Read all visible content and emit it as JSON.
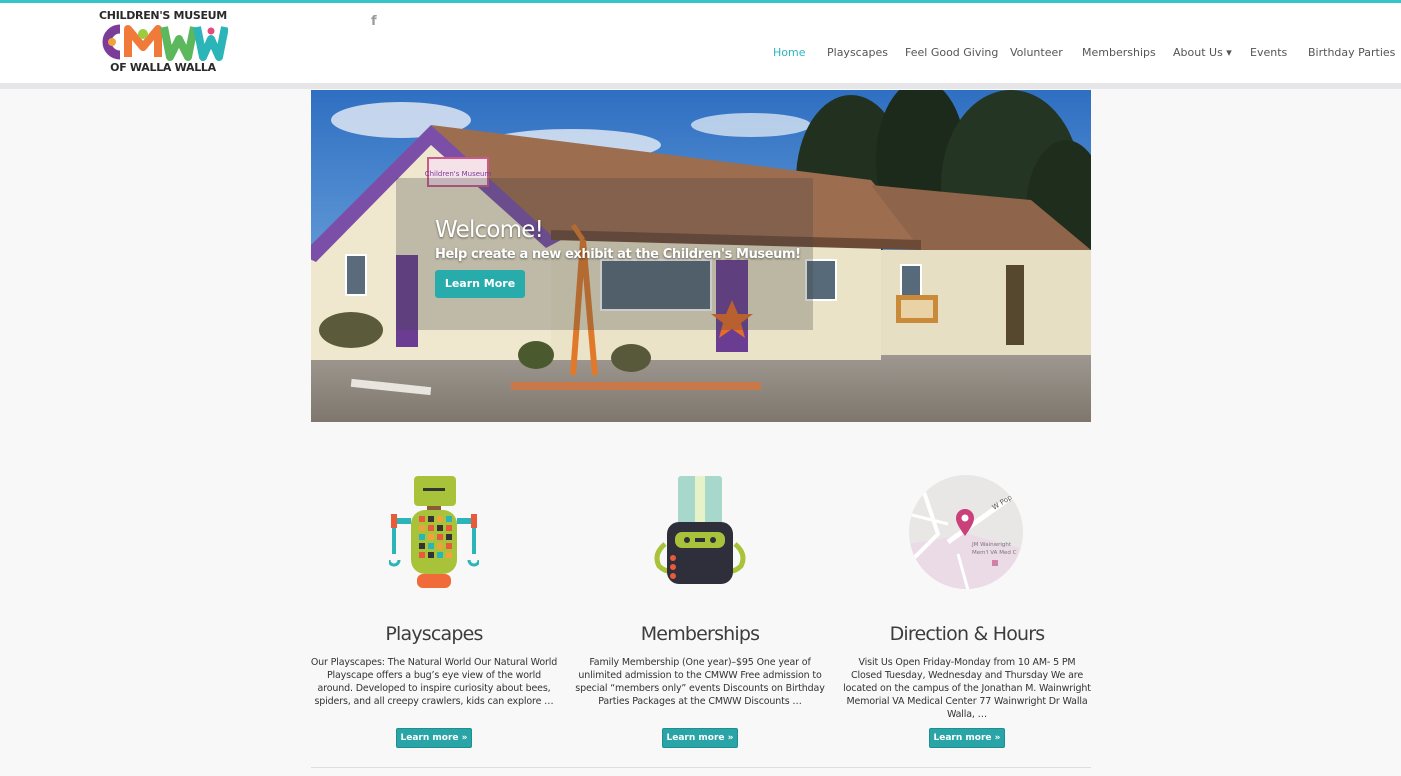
{
  "brand": {
    "logo_top": "CHILDREN'S MUSEUM",
    "logo_mark": "CMWW",
    "logo_bottom": "OF WALLA WALLA",
    "accent": "#34c3c6"
  },
  "social": {
    "facebook_icon": "facebook-icon",
    "facebook_glyph": "f"
  },
  "nav": {
    "items": [
      {
        "label": "Home",
        "active": true
      },
      {
        "label": "Playscapes"
      },
      {
        "label": "Feel Good Giving"
      },
      {
        "label": "Volunteer"
      },
      {
        "label": "Memberships"
      },
      {
        "label": "About Us ▾"
      },
      {
        "label": "Events"
      },
      {
        "label": "Birthday Parties"
      }
    ]
  },
  "hero": {
    "title": "Welcome!",
    "subtitle": "Help create a new exhibit at the Children's Museum!",
    "button": "Learn More",
    "sign": "Children's Museum"
  },
  "features": [
    {
      "icon": "robot-icon",
      "title": "Playscapes",
      "text": "Our Playscapes: The Natural World Our Natural World Playscape offers a bug’s eye view of the world around. Developed to inspire curiosity about bees, spiders, and all creepy crawlers, kids can explore …",
      "button": "Learn more »"
    },
    {
      "icon": "membership-card-icon",
      "title": "Memberships",
      "text": "Family Membership (One year)–$95       One year of unlimited admission to the CMWW Free admission to special “members only” events Discounts on Birthday Parties Packages at the CMWW Discounts …",
      "button": "Learn more »"
    },
    {
      "icon": "map-icon",
      "title": "Direction & Hours",
      "text": "Visit Us Open Friday-Monday from 10 AM- 5 PM Closed Tuesday, Wednesday and Thursday We are located on the campus of the Jonathan M. Wainwright Memorial VA Medical Center 77 Wainwright Dr Walla Walla, …",
      "button": "Learn more »",
      "map_labels": [
        "W Poplar",
        "JM Wainwright",
        "Mem'l VA Med C"
      ]
    }
  ]
}
